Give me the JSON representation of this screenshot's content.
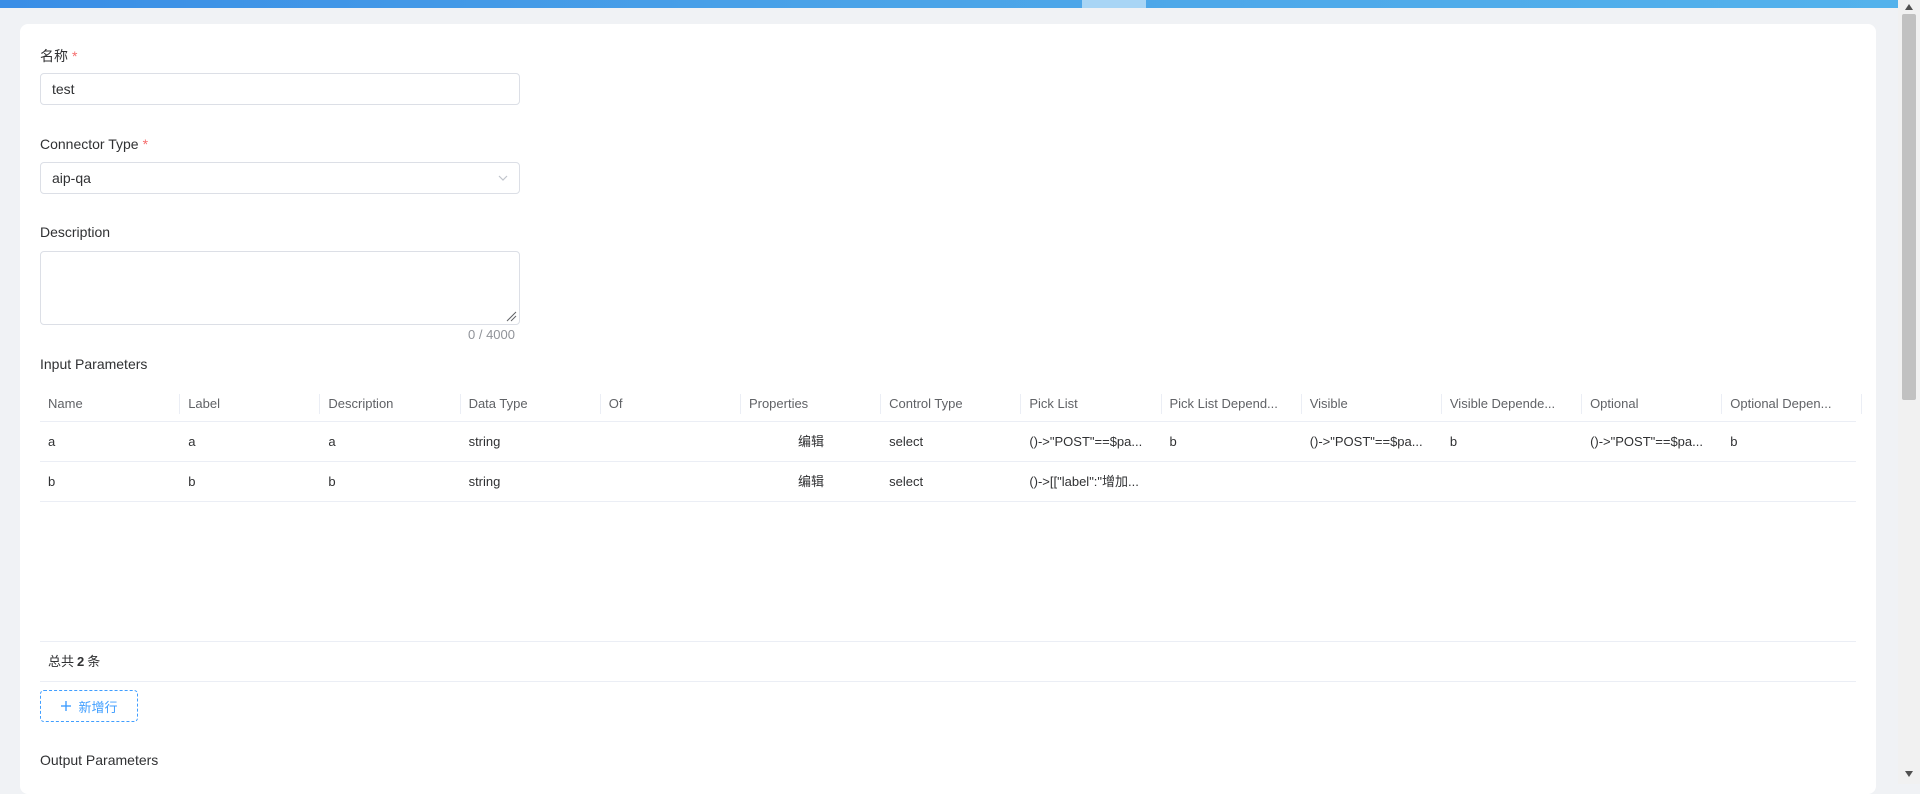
{
  "form": {
    "name_label": "名称",
    "name_required": "*",
    "name_value": "test",
    "connector_type_label": "Connector Type",
    "connector_type_required": "*",
    "connector_type_value": "aip-qa",
    "description_label": "Description",
    "description_value": "",
    "description_counter": "0 / 4000"
  },
  "input_parameters": {
    "title": "Input Parameters",
    "columns": [
      "Name",
      "Label",
      "Description",
      "Data Type",
      "Of",
      "Properties",
      "Control Type",
      "Pick List",
      "Pick List Depend...",
      "Visible",
      "Visible Depende...",
      "Optional",
      "Optional Depen..."
    ],
    "rows": [
      [
        "a",
        "a",
        "a",
        "string",
        "",
        "编辑",
        "select",
        "()->\"POST\"==$pa...",
        "b",
        "()->\"POST\"==$pa...",
        "b",
        "()->\"POST\"==$pa...",
        "b"
      ],
      [
        "b",
        "b",
        "b",
        "string",
        "",
        "编辑",
        "select",
        "()->[[\"label\":\"增加...",
        "",
        "",
        "",
        "",
        ""
      ]
    ],
    "total_prefix": "总共",
    "total_count": "2",
    "total_suffix": "条",
    "add_row_label": "新增行",
    "add_row_icon": "plus-icon"
  },
  "output_parameters": {
    "title": "Output Parameters"
  },
  "colors": {
    "accent": "#409eff",
    "required": "#f56c6c",
    "topbar": "#3a8ee6"
  }
}
